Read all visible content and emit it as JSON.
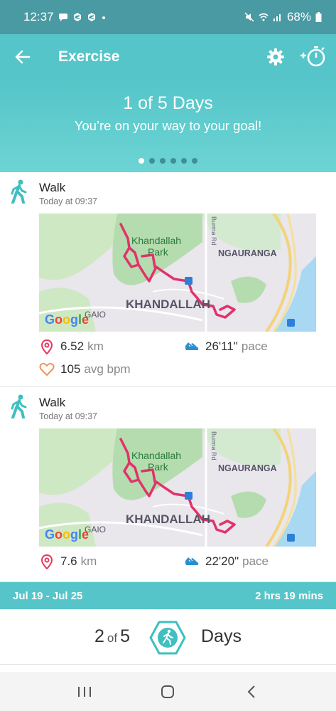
{
  "status_bar": {
    "time": "12:37",
    "battery": "68%"
  },
  "app_bar": {
    "title": "Exercise"
  },
  "banner": {
    "headline": "1 of 5 Days",
    "subtext": "You’re on your way to your goal!",
    "pages": 6,
    "active_page": 1
  },
  "activities": [
    {
      "type": "Walk",
      "time": "Today at 09:37",
      "map": {
        "park": "Khandallah\nPark",
        "suburb": "KHANDALLAH",
        "district": "NGAURANGA",
        "road": "Burma Rd",
        "area": "NGAIO",
        "provider": "Google"
      },
      "distance": {
        "value": "6.52",
        "unit": "km"
      },
      "pace": {
        "value": "26'11\"",
        "unit": "pace"
      },
      "heart_rate": {
        "value": "105",
        "unit": "avg bpm"
      }
    },
    {
      "type": "Walk",
      "time": "Today at 09:37",
      "map": {
        "park": "Khandallah\nPark",
        "suburb": "KHANDALLAH",
        "district": "NGAURANGA",
        "road": "Burma Rd",
        "area": "NGAIO",
        "provider": "Google"
      },
      "distance": {
        "value": "7.6",
        "unit": "km"
      },
      "pace": {
        "value": "22'20\"",
        "unit": "pace"
      }
    }
  ],
  "week": {
    "range": "Jul 19 - Jul 25",
    "total": "2 hrs 19 mins"
  },
  "summary": {
    "done": "2",
    "of_label": "of",
    "goal": "5",
    "unit": "Days"
  },
  "colors": {
    "teal": "#55c5c9",
    "status": "#4a9aa3",
    "route": "#e0336a",
    "walk_icon": "#3fbfc0",
    "pin": "#e8385f",
    "heart": "#f0945c",
    "shoe": "#2b8fcf"
  }
}
